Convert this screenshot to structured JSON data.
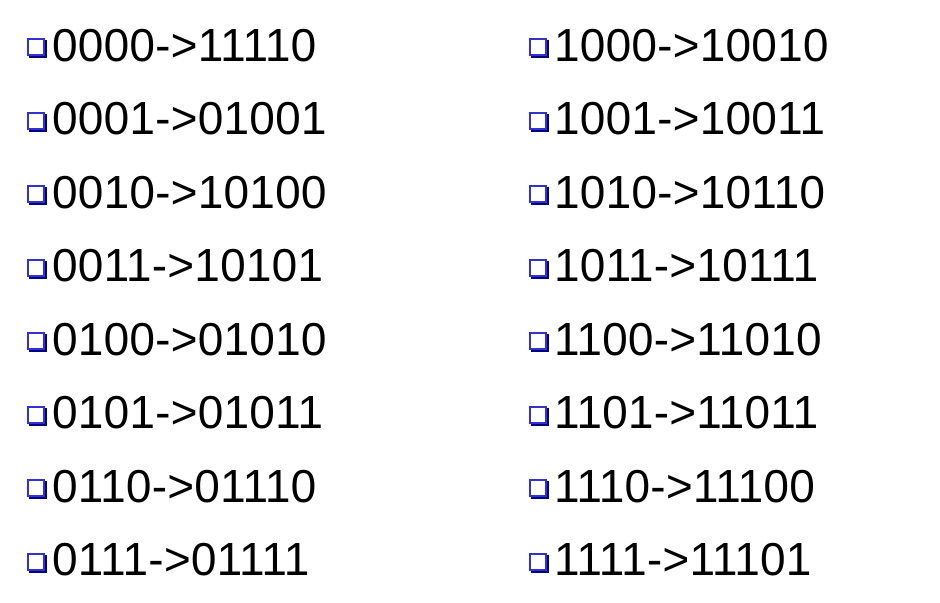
{
  "bullet": {
    "icon": "hollow-square-bullet-icon",
    "color": "#3333cc",
    "shadow_color": "#000080"
  },
  "columns": [
    {
      "items": [
        {
          "text": "0000->11110"
        },
        {
          "text": "0001->01001"
        },
        {
          "text": "0010->10100"
        },
        {
          "text": "0011->10101"
        },
        {
          "text": "0100->01010"
        },
        {
          "text": "0101->01011"
        },
        {
          "text": "0110->01110"
        },
        {
          "text": "0111->01111"
        }
      ]
    },
    {
      "items": [
        {
          "text": "1000->10010"
        },
        {
          "text": "1001->10011"
        },
        {
          "text": "1010->10110"
        },
        {
          "text": "1011->10111"
        },
        {
          "text": "1100->11010"
        },
        {
          "text": "1101->11011"
        },
        {
          "text": "1110->11100"
        },
        {
          "text": "1111->11101"
        }
      ]
    }
  ]
}
